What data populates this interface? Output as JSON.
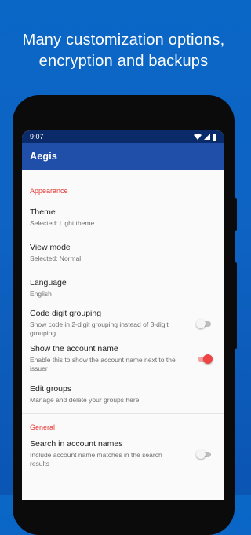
{
  "headline": {
    "line1": "Many customization options,",
    "line2": "encryption and backups"
  },
  "status_bar": {
    "time": "9:07",
    "icons": [
      "wifi-icon",
      "cellular-signal-icon",
      "battery-icon"
    ]
  },
  "app_bar": {
    "title": "Aegis"
  },
  "sections": {
    "appearance": {
      "title": "Appearance",
      "items": {
        "theme": {
          "title": "Theme",
          "summary": "Selected: Light theme"
        },
        "view_mode": {
          "title": "View mode",
          "summary": "Selected: Normal"
        },
        "language": {
          "title": "Language",
          "summary": "English"
        },
        "code_grouping": {
          "title": "Code digit grouping",
          "summary": "Show code in 2-digit grouping instead of 3-digit grouping",
          "toggle_on": false
        },
        "show_account_name": {
          "title": "Show the account name",
          "summary": "Enable this to show the account name next to the issuer",
          "toggle_on": true
        },
        "edit_groups": {
          "title": "Edit groups",
          "summary": "Manage and delete your groups here"
        }
      }
    },
    "general": {
      "title": "General",
      "items": {
        "search_account_names": {
          "title": "Search in account names",
          "summary": "Include account name matches in the search results",
          "toggle_on": false
        }
      }
    }
  },
  "colors": {
    "background": "#0b63c4",
    "app_bar": "#1f4fa9",
    "status_bar": "#0b2a6a",
    "accent": "#e53935"
  }
}
